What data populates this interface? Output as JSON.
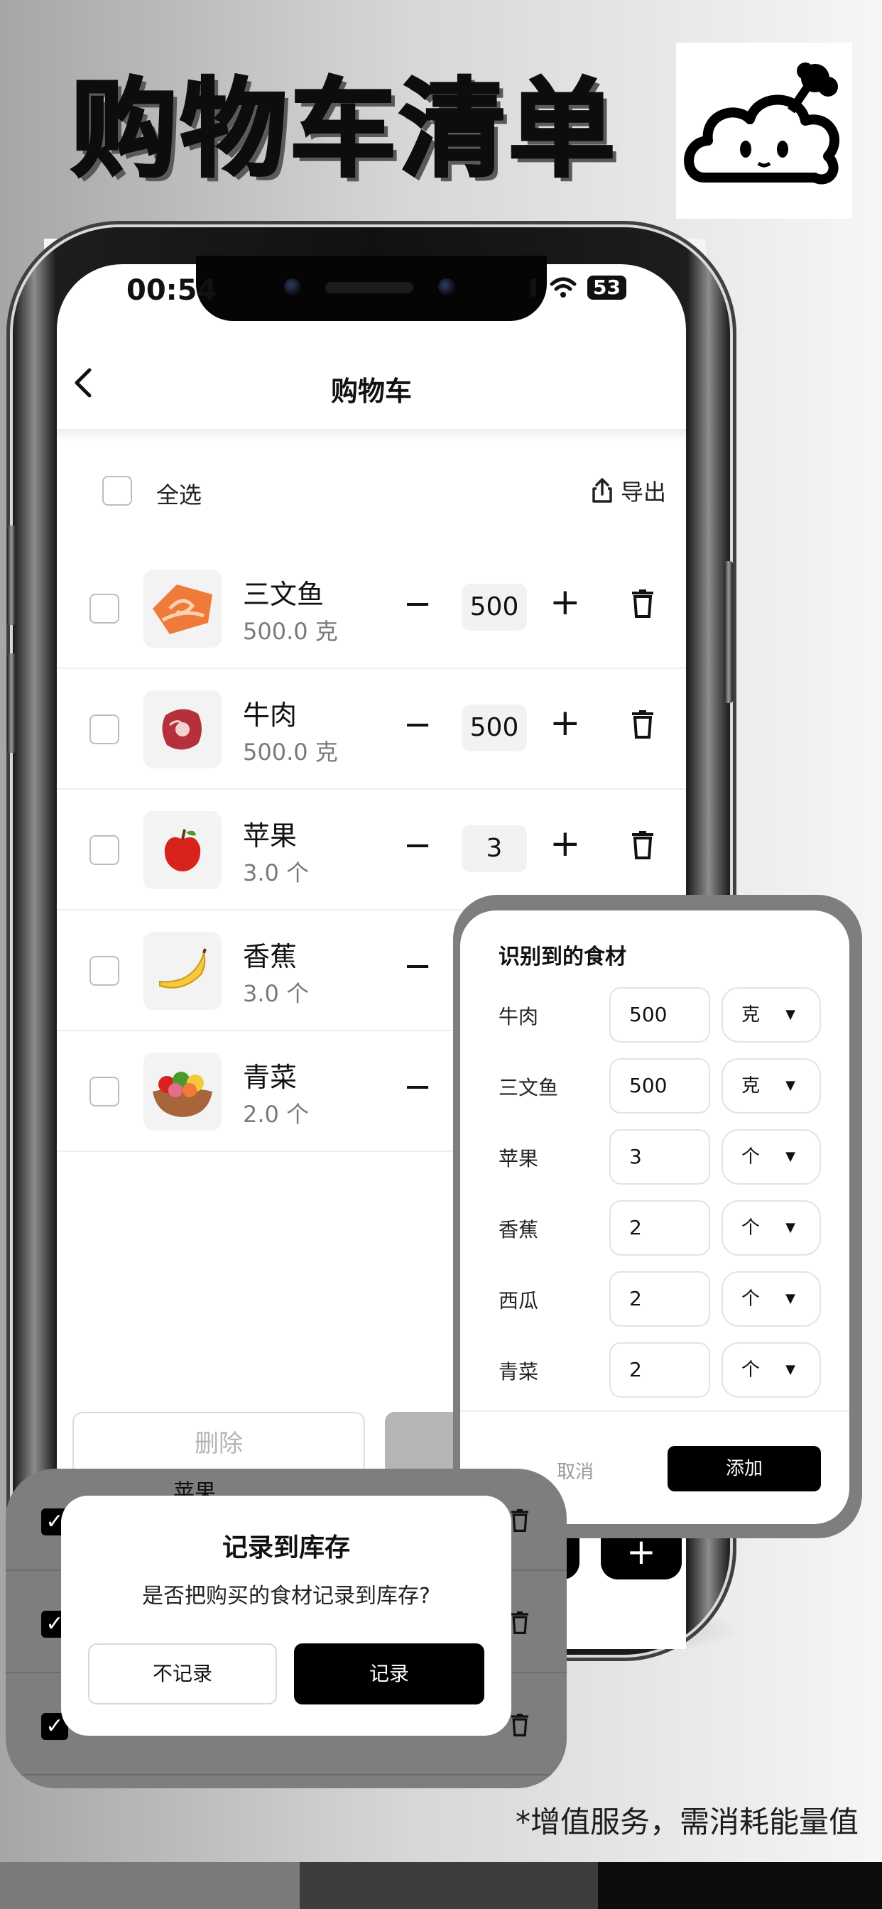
{
  "headline": "购物车清单",
  "status_bar": {
    "time": "00:54",
    "battery": "53"
  },
  "nav": {
    "back_icon": "chevron-left-icon",
    "title": "购物车"
  },
  "toolbar": {
    "select_all_label": "全选",
    "export_label": "导出",
    "export_icon": "share-icon"
  },
  "cart_items": [
    {
      "name": "三文鱼",
      "amount": "500.0 克",
      "count": "500",
      "icon": "salmon-icon"
    },
    {
      "name": "牛肉",
      "amount": "500.0 克",
      "count": "500",
      "icon": "beef-icon"
    },
    {
      "name": "苹果",
      "amount": "3.0 个",
      "count": "3",
      "icon": "apple-icon"
    },
    {
      "name": "香蕉",
      "amount": "3.0 个",
      "count": "",
      "icon": "banana-icon"
    },
    {
      "name": "青菜",
      "amount": "2.0 个",
      "count": "",
      "icon": "basket-icon"
    }
  ],
  "controls": {
    "minus": "−",
    "plus": "+"
  },
  "bottom_bar": {
    "delete_label": "删除"
  },
  "ingredients_dialog": {
    "title": "识别到的食材",
    "items": [
      {
        "name": "牛肉",
        "quantity": "500",
        "unit": "克"
      },
      {
        "name": "三文鱼",
        "quantity": "500",
        "unit": "克"
      },
      {
        "name": "苹果",
        "quantity": "3",
        "unit": "个"
      },
      {
        "name": "香蕉",
        "quantity": "2",
        "unit": "个"
      },
      {
        "name": "西瓜",
        "quantity": "2",
        "unit": "个"
      },
      {
        "name": "青菜",
        "quantity": "2",
        "unit": "个"
      }
    ],
    "caret": "▼",
    "cancel_label": "取消",
    "add_label": "添加"
  },
  "inventory_dialog": {
    "background_item": "苹果",
    "title": "记录到库存",
    "message": "是否把购买的食材记录到库存?",
    "no_label": "不记录",
    "yes_label": "记录"
  },
  "footnote": "*增值服务，需消耗能量值",
  "colors": {
    "accent": "#000000",
    "stripe_1": "#7a7a7a",
    "stripe_2": "#3d3d3d",
    "stripe_3": "#0d0d0d"
  }
}
